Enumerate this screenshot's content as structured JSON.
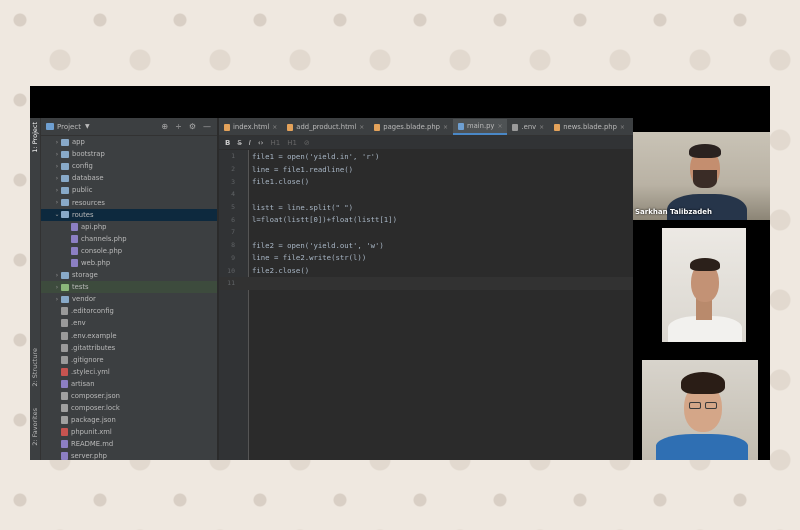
{
  "sidebar_tabs": {
    "project": "1: Project",
    "structure": "2: Structure",
    "favorites": "2: Favorites"
  },
  "project_panel": {
    "title": "Project",
    "tree": [
      {
        "label": "app",
        "type": "folder",
        "depth": 1,
        "expanded": false
      },
      {
        "label": "bootstrap",
        "type": "folder",
        "depth": 1,
        "expanded": false
      },
      {
        "label": "config",
        "type": "folder",
        "depth": 1,
        "expanded": false
      },
      {
        "label": "database",
        "type": "folder",
        "depth": 1,
        "expanded": false
      },
      {
        "label": "public",
        "type": "folder",
        "depth": 1,
        "expanded": false
      },
      {
        "label": "resources",
        "type": "folder",
        "depth": 1,
        "expanded": false
      },
      {
        "label": "routes",
        "type": "folder",
        "depth": 1,
        "expanded": true
      },
      {
        "label": "api.php",
        "type": "php",
        "depth": 2
      },
      {
        "label": "channels.php",
        "type": "php",
        "depth": 2
      },
      {
        "label": "console.php",
        "type": "php",
        "depth": 2
      },
      {
        "label": "web.php",
        "type": "php",
        "depth": 2
      },
      {
        "label": "storage",
        "type": "folder",
        "depth": 1,
        "expanded": false
      },
      {
        "label": "tests",
        "type": "folder-green",
        "depth": 1,
        "expanded": false
      },
      {
        "label": "vendor",
        "type": "folder",
        "depth": 1,
        "expanded": false
      },
      {
        "label": ".editorconfig",
        "type": "config",
        "depth": 1
      },
      {
        "label": ".env",
        "type": "config",
        "depth": 1
      },
      {
        "label": ".env.example",
        "type": "config",
        "depth": 1
      },
      {
        "label": ".gitattributes",
        "type": "config",
        "depth": 1
      },
      {
        "label": ".gitignore",
        "type": "config",
        "depth": 1
      },
      {
        "label": ".styleci.yml",
        "type": "red",
        "depth": 1
      },
      {
        "label": "artisan",
        "type": "php",
        "depth": 1
      },
      {
        "label": "composer.json",
        "type": "json",
        "depth": 1
      },
      {
        "label": "composer.lock",
        "type": "json",
        "depth": 1
      },
      {
        "label": "package.json",
        "type": "json",
        "depth": 1
      },
      {
        "label": "phpunit.xml",
        "type": "red",
        "depth": 1
      },
      {
        "label": "README.md",
        "type": "php",
        "depth": 1
      },
      {
        "label": "server.php",
        "type": "php",
        "depth": 1
      }
    ]
  },
  "editor": {
    "tabs": [
      {
        "label": "index.html",
        "active": false,
        "color": "#e4a25a"
      },
      {
        "label": "add_product.html",
        "active": false,
        "color": "#e4a25a"
      },
      {
        "label": "pages.blade.php",
        "active": false,
        "color": "#e4a25a"
      },
      {
        "label": "main.py",
        "active": true,
        "color": "#6e9fd1"
      },
      {
        "label": ".env",
        "active": false,
        "color": "#9a9a9a"
      },
      {
        "label": "news.blade.php",
        "active": false,
        "color": "#e4a25a"
      }
    ],
    "lines": [
      {
        "n": "1",
        "text": "file1 = open('yield.in', 'r')"
      },
      {
        "n": "2",
        "text": "line = file1.readline()"
      },
      {
        "n": "3",
        "text": "file1.close()"
      },
      {
        "n": "4",
        "text": ""
      },
      {
        "n": "5",
        "text": "listt = line.split(\" \")"
      },
      {
        "n": "6",
        "text": "l=float(listt[0])+float(listt[1])"
      },
      {
        "n": "7",
        "text": ""
      },
      {
        "n": "8",
        "text": "file2 = open('yield.out', 'w')"
      },
      {
        "n": "9",
        "text": "line = file2.write(str(l))"
      },
      {
        "n": "10",
        "text": "file2.close()"
      },
      {
        "n": "11",
        "text": ""
      }
    ],
    "current_line": 11
  },
  "webcams": {
    "participant1_name": "Sarkhan Talibzadeh"
  },
  "colors": {
    "ide_bg": "#2b2b2b",
    "panel_bg": "#3c3f41",
    "selection": "#0d293e",
    "accent": "#4a88c7"
  }
}
